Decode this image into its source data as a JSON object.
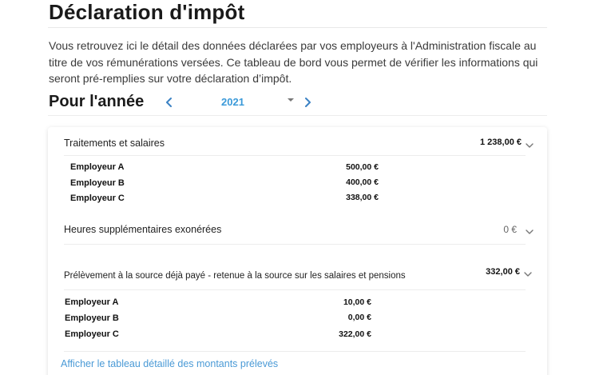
{
  "header": {
    "title": "Déclaration d'impôt",
    "intro": "Vous retrouvez ici le détail des données déclarées par vos employeurs à l'Administration fiscale au titre de vos rémunérations versées. Ce tableau de bord vous permet de vérifier les informations qui seront pré-remplies sur votre déclaration d’impôt."
  },
  "year_selector": {
    "label": "Pour l'année",
    "selected_year": "2021",
    "prev_icon": "chevron-left-icon",
    "next_icon": "chevron-right-icon",
    "caret_icon": "caret-down-icon"
  },
  "sections": {
    "salaries": {
      "label": "Traitements et salaires",
      "total": "1 238,00 €",
      "employers": [
        {
          "name": "Employeur A",
          "amount": "500,00 €"
        },
        {
          "name": "Employeur B",
          "amount": "400,00 €"
        },
        {
          "name": "Employeur C",
          "amount": "338,00 €"
        }
      ]
    },
    "overtime": {
      "label": "Heures supplémentaires exonérées",
      "total": "0 €"
    },
    "withholding": {
      "label": "Prélèvement à la source déjà payé - retenue à la source sur les salaires et pensions",
      "total": "332,00 €",
      "employers": [
        {
          "name": "Employeur A",
          "amount": "10,00 €"
        },
        {
          "name": "Employeur B",
          "amount": "0,00 €"
        },
        {
          "name": "Employeur C",
          "amount": "322,00 €"
        }
      ]
    }
  },
  "detail_link": "Afficher le tableau détaillé des montants prélevés",
  "colors": {
    "accent": "#3b9ad9",
    "link": "#4a9ad6",
    "divider": "#ececec"
  }
}
